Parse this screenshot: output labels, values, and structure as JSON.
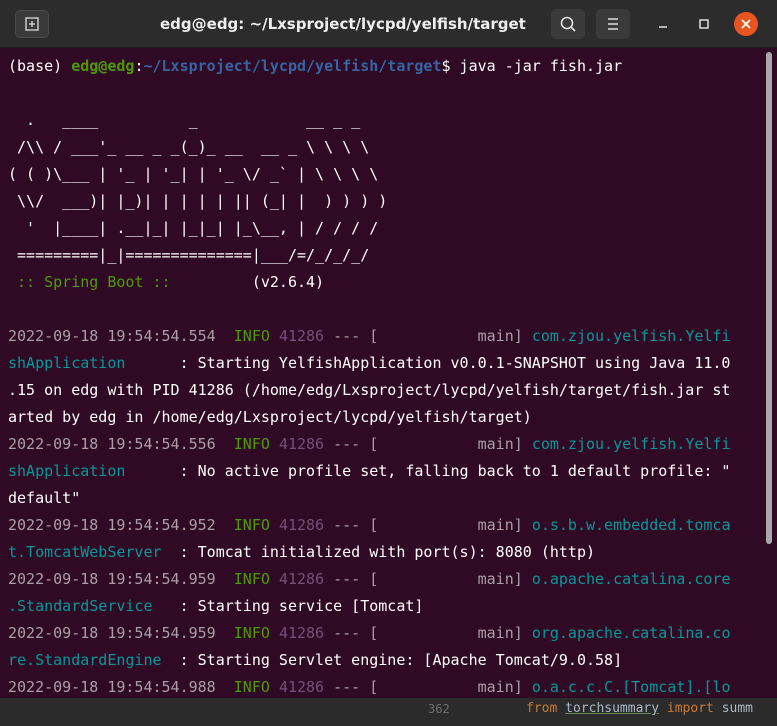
{
  "window": {
    "title": "edg@edg: ~/Lxsproject/lycpd/yelfish/target",
    "icons": [
      "new-tab-icon",
      "search-icon",
      "hamburger-menu-icon",
      "minimize-icon",
      "maximize-icon",
      "close-icon"
    ],
    "colors": {
      "background": "#300a24",
      "titlebar": "#2c2c2c",
      "close": "#e95420",
      "prompt_user": "#4e9a06",
      "prompt_path": "#3465a4"
    }
  },
  "terminal": {
    "prompt_env": "(base) ",
    "prompt_user": "edg@edg",
    "prompt_sep": ":",
    "prompt_path": "~/Lxsproject/lycpd/yelfish/target",
    "prompt_symbol": "$ ",
    "command": "java -jar fish.jar",
    "banner": [
      "  .   ____          _            __ _ _",
      " /\\\\ / ___'_ __ _ _(_)_ __  __ _ \\ \\ \\ \\",
      "( ( )\\___ | '_ | '_| | '_ \\/ _` | \\ \\ \\ \\",
      " \\\\/  ___)| |_)| | | | | || (_| |  ) ) ) )",
      "  '  |____| .__|_| |_|_| |_\\__, | / / / /",
      " =========|_|==============|___/=/_/_/_/"
    ],
    "spring_label": " :: Spring Boot :: ",
    "spring_version": "(v2.6.4)",
    "log": [
      {
        "ts": "2022-09-18 19:54:54.554",
        "level": "INFO",
        "pid": "41286",
        "sep": "--- [",
        "thread": "main]",
        "logger_a": "com.zjou.yelfish.Yelfi",
        "logger_b": "shApplication",
        "msg_a": "      : Starting YelfishApplication v0.0.1-SNAPSHOT using Java 11.0",
        "cont": [
          ".15 on edg with PID 41286 (/home/edg/Lxsproject/lycpd/yelfish/target/fish.jar st",
          "arted by edg in /home/edg/Lxsproject/lycpd/yelfish/target)"
        ]
      },
      {
        "ts": "2022-09-18 19:54:54.556",
        "level": "INFO",
        "pid": "41286",
        "sep": "--- [",
        "thread": "main]",
        "logger_a": "com.zjou.yelfish.Yelfi",
        "logger_b": "shApplication",
        "msg_a": "      : No active profile set, falling back to 1 default profile: \"",
        "cont": [
          "default\""
        ]
      },
      {
        "ts": "2022-09-18 19:54:54.952",
        "level": "INFO",
        "pid": "41286",
        "sep": "--- [",
        "thread": "main]",
        "logger_a": "o.s.b.w.embedded.tomca",
        "logger_b": "t.TomcatWebServer",
        "msg_a": "  : Tomcat initialized with port(s): 8080 (http)",
        "cont": []
      },
      {
        "ts": "2022-09-18 19:54:54.959",
        "level": "INFO",
        "pid": "41286",
        "sep": "--- [",
        "thread": "main]",
        "logger_a": "o.apache.catalina.core",
        "logger_b": ".StandardService",
        "msg_a": "   : Starting service [Tomcat]",
        "cont": []
      },
      {
        "ts": "2022-09-18 19:54:54.959",
        "level": "INFO",
        "pid": "41286",
        "sep": "--- [",
        "thread": "main]",
        "logger_a": "org.apache.catalina.co",
        "logger_b": "re.StandardEngine",
        "msg_a": "  : Starting Servlet engine: [Apache Tomcat/9.0.58]",
        "cont": []
      },
      {
        "ts": "2022-09-18 19:54:54.988",
        "level": "INFO",
        "pid": "41286",
        "sep": "--- [",
        "thread": "main]",
        "logger_a": "o.a.c.c.C.[Tomcat].[lo",
        "logger_b": "",
        "msg_a": "",
        "cont": []
      }
    ]
  },
  "editor_behind": {
    "line_number": "362",
    "kw_from": "from",
    "module": "torchsummary",
    "kw_import": "import",
    "rest": "summ"
  }
}
